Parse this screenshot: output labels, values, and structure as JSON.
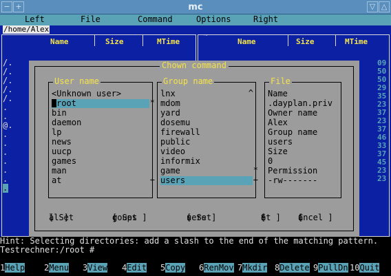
{
  "window": {
    "title": "mc",
    "buttons": [
      "minimize-icon",
      "maximize-icon",
      "restore-icon",
      "close-icon"
    ]
  },
  "menu": {
    "items": [
      "Left",
      "File",
      "Command",
      "Options",
      "Right"
    ]
  },
  "left_panel": {
    "path": "/home/Alex",
    "columns": [
      "Name",
      "Size",
      "MTime"
    ],
    "row_marks": [
      "/.",
      "/.",
      "/.",
      "/.",
      "/.",
      ".",
      ".",
      "@.",
      ".",
      ".",
      ".",
      ".",
      ".",
      ".",
      "."
    ]
  },
  "right_panel": {
    "path": "~",
    "columns": [
      "Name",
      "Size",
      "MTime"
    ],
    "right_digits": [
      "09",
      "50",
      "50",
      "29",
      "35",
      "23",
      "37",
      "23",
      "37",
      "46",
      "33",
      "37",
      "45",
      "23",
      "23"
    ]
  },
  "dialog": {
    "title": "Chown command",
    "user_box": {
      "title": "User name",
      "items": [
        "<Unknown user>",
        "root",
        "bin",
        "daemon",
        "lp",
        "news",
        "uucp",
        "games",
        "man",
        "at"
      ],
      "selected": 1
    },
    "group_box": {
      "title": "Group name",
      "items": [
        "lnx",
        "mdom",
        "yard",
        "dosemu",
        "firewall",
        "public",
        "video",
        "informix",
        "game",
        "users"
      ],
      "selected": 9
    },
    "file_box": {
      "title": "File",
      "items": [
        "Name",
        ".dayplan.priv",
        "Owner name",
        "Alex",
        "Group name",
        "users",
        "Size",
        "0",
        "Permission",
        "-rw-------"
      ]
    },
    "buttons": [
      {
        "pre": "[ Set ",
        "hot": "a",
        "post": "ll ]"
      },
      {
        "pre": "[ Set ",
        "hot": "g",
        "post": "roups ]"
      },
      {
        "pre": "[ Set ",
        "hot": "u",
        "post": "sers ]"
      },
      {
        "pre": "[ ",
        "hot": "S",
        "post": "et ]"
      },
      {
        "pre": "[ ",
        "hot": "C",
        "post": "ancel ]"
      }
    ]
  },
  "hint": "Hint: Selecting directories: add a slash to the end of the matching pattern.",
  "prompt": "Testrechner:/root #",
  "fkeys": [
    {
      "num": "1",
      "label": "Help"
    },
    {
      "num": "2",
      "label": "Menu"
    },
    {
      "num": "3",
      "label": "View"
    },
    {
      "num": "4",
      "label": "Edit"
    },
    {
      "num": "5",
      "label": "Copy"
    },
    {
      "num": "6",
      "label": "RenMov"
    },
    {
      "num": "7",
      "label": "Mkdir"
    },
    {
      "num": "8",
      "label": "Delete"
    },
    {
      "num": "9",
      "label": "PullDn"
    },
    {
      "num": "10",
      "label": "Quit"
    }
  ],
  "colors": {
    "panel_bg": "#0c20a4",
    "dialog_bg": "#9c9c9c",
    "selection": "#5aa3b6",
    "hotkey": "#f5e34a",
    "titlebar": "#5a8fbd"
  }
}
